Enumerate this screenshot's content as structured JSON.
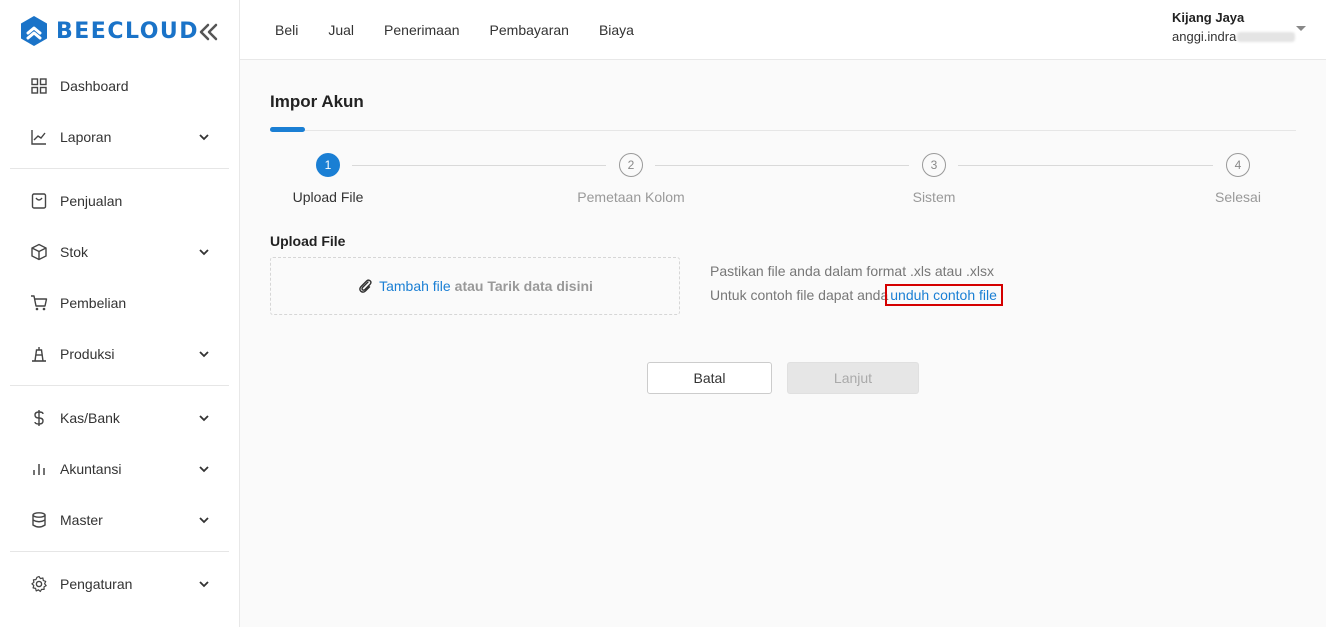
{
  "brand": {
    "name": "BEECLOUD",
    "color": "#1a73c8"
  },
  "sidebar": {
    "collapse_icon": "double-chevron-left-icon",
    "items": [
      {
        "label": "Dashboard",
        "icon": "grid-icon",
        "expandable": false
      },
      {
        "label": "Laporan",
        "icon": "line-chart-icon",
        "expandable": true
      },
      {
        "label": "Penjualan",
        "icon": "receipt-icon",
        "expandable": false
      },
      {
        "label": "Stok",
        "icon": "box-icon",
        "expandable": true
      },
      {
        "label": "Pembelian",
        "icon": "cart-icon",
        "expandable": false
      },
      {
        "label": "Produksi",
        "icon": "factory-icon",
        "expandable": true
      },
      {
        "label": "Kas/Bank",
        "icon": "dollar-icon",
        "expandable": true
      },
      {
        "label": "Akuntansi",
        "icon": "bar-chart-icon",
        "expandable": true
      },
      {
        "label": "Master",
        "icon": "database-icon",
        "expandable": true
      },
      {
        "label": "Pengaturan",
        "icon": "gear-icon",
        "expandable": true
      }
    ]
  },
  "topnav": [
    "Beli",
    "Jual",
    "Penerimaan",
    "Pembayaran",
    "Biaya"
  ],
  "user": {
    "company": "Kijang Jaya",
    "email_visible": "anggi.indra"
  },
  "page": {
    "title": "Impor Akun",
    "steps": [
      {
        "number": "1",
        "label": "Upload File",
        "active": true
      },
      {
        "number": "2",
        "label": "Pemetaan Kolom",
        "active": false
      },
      {
        "number": "3",
        "label": "Sistem",
        "active": false
      },
      {
        "number": "4",
        "label": "Selesai",
        "active": false
      }
    ],
    "upload": {
      "section_title": "Upload File",
      "add_file_link": "Tambah file",
      "drag_text": "atau Tarik data disini",
      "hint_line1": "Pastikan file anda dalam format .xls atau .xlsx",
      "hint_line2": "Untuk contoh file dapat anda",
      "download_link": "unduh contoh file"
    },
    "buttons": {
      "cancel": "Batal",
      "next": "Lanjut"
    },
    "accent_color": "#1a7fd4",
    "highlight_color": "#d40000"
  }
}
